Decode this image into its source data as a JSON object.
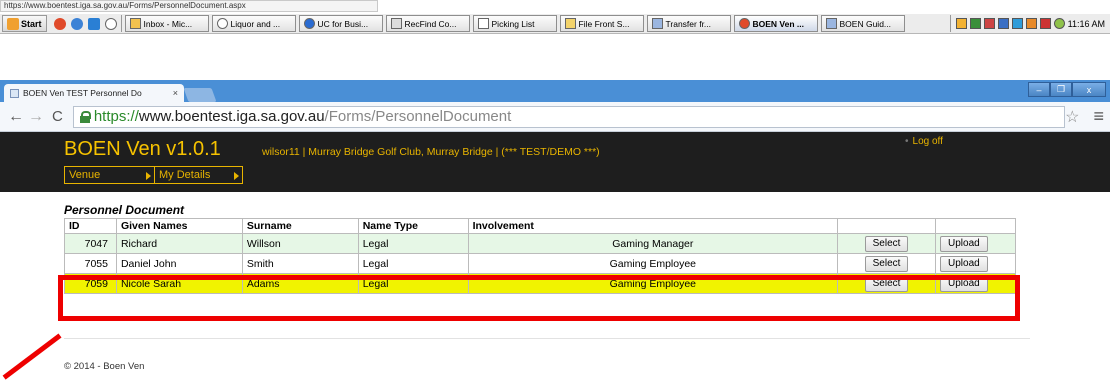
{
  "url_tooltip": "https://www.boentest.iga.sa.gov.au/Forms/PersonnelDocument.aspx",
  "taskbar": {
    "start": "Start",
    "tasks": [
      "Inbox - Mic...",
      "Liquor and ...",
      "UC for Busi...",
      "RecFind Co...",
      "Picking List",
      "File Front S...",
      "Transfer fr...",
      "BOEN Ven ...",
      "BOEN Guid..."
    ],
    "active_task_index": 7,
    "clock": "11:16 AM"
  },
  "browser": {
    "tab_title": "BOEN Ven TEST Personnel Do",
    "tab_close": "×",
    "url_scheme": "https://",
    "url_host": "www.boentest.iga.sa.gov.au",
    "url_path": "/Forms/PersonnelDocument",
    "window_minimize": "–",
    "window_restore": "❐",
    "window_close": "x"
  },
  "site": {
    "brand": "BOEN Ven v1.0.1",
    "user_info": "wilsor11  |  Murray Bridge Golf Club, Murray Bridge  |  (*** TEST/DEMO ***)",
    "logoff": "Log off",
    "menu": [
      "Venue",
      "My Details"
    ]
  },
  "page": {
    "heading": "Personnel Document",
    "columns": [
      "ID",
      "Given Names",
      "Surname",
      "Name Type",
      "Involvement",
      "",
      ""
    ],
    "rows": [
      {
        "id": "7047",
        "given": "Richard",
        "surname": "Willson",
        "name_type": "Legal",
        "involvement": "Gaming Manager",
        "select": "Select",
        "upload": "Upload"
      },
      {
        "id": "7055",
        "given": "Daniel John",
        "surname": "Smith",
        "name_type": "Legal",
        "involvement": "Gaming Employee",
        "select": "Select",
        "upload": "Upload"
      },
      {
        "id": "7059",
        "given": "Nicole Sarah",
        "surname": "Adams",
        "name_type": "Legal",
        "involvement": "Gaming Employee",
        "select": "Select",
        "upload": "Upload"
      }
    ]
  },
  "footer": "© 2014 - Boen Ven",
  "colors": {
    "header_bg": "#1e1e1e",
    "brand": "#f7c300",
    "row_normal": "#e6f7e6",
    "row_selected": "#f1f300",
    "annotation": "#ee0000"
  }
}
